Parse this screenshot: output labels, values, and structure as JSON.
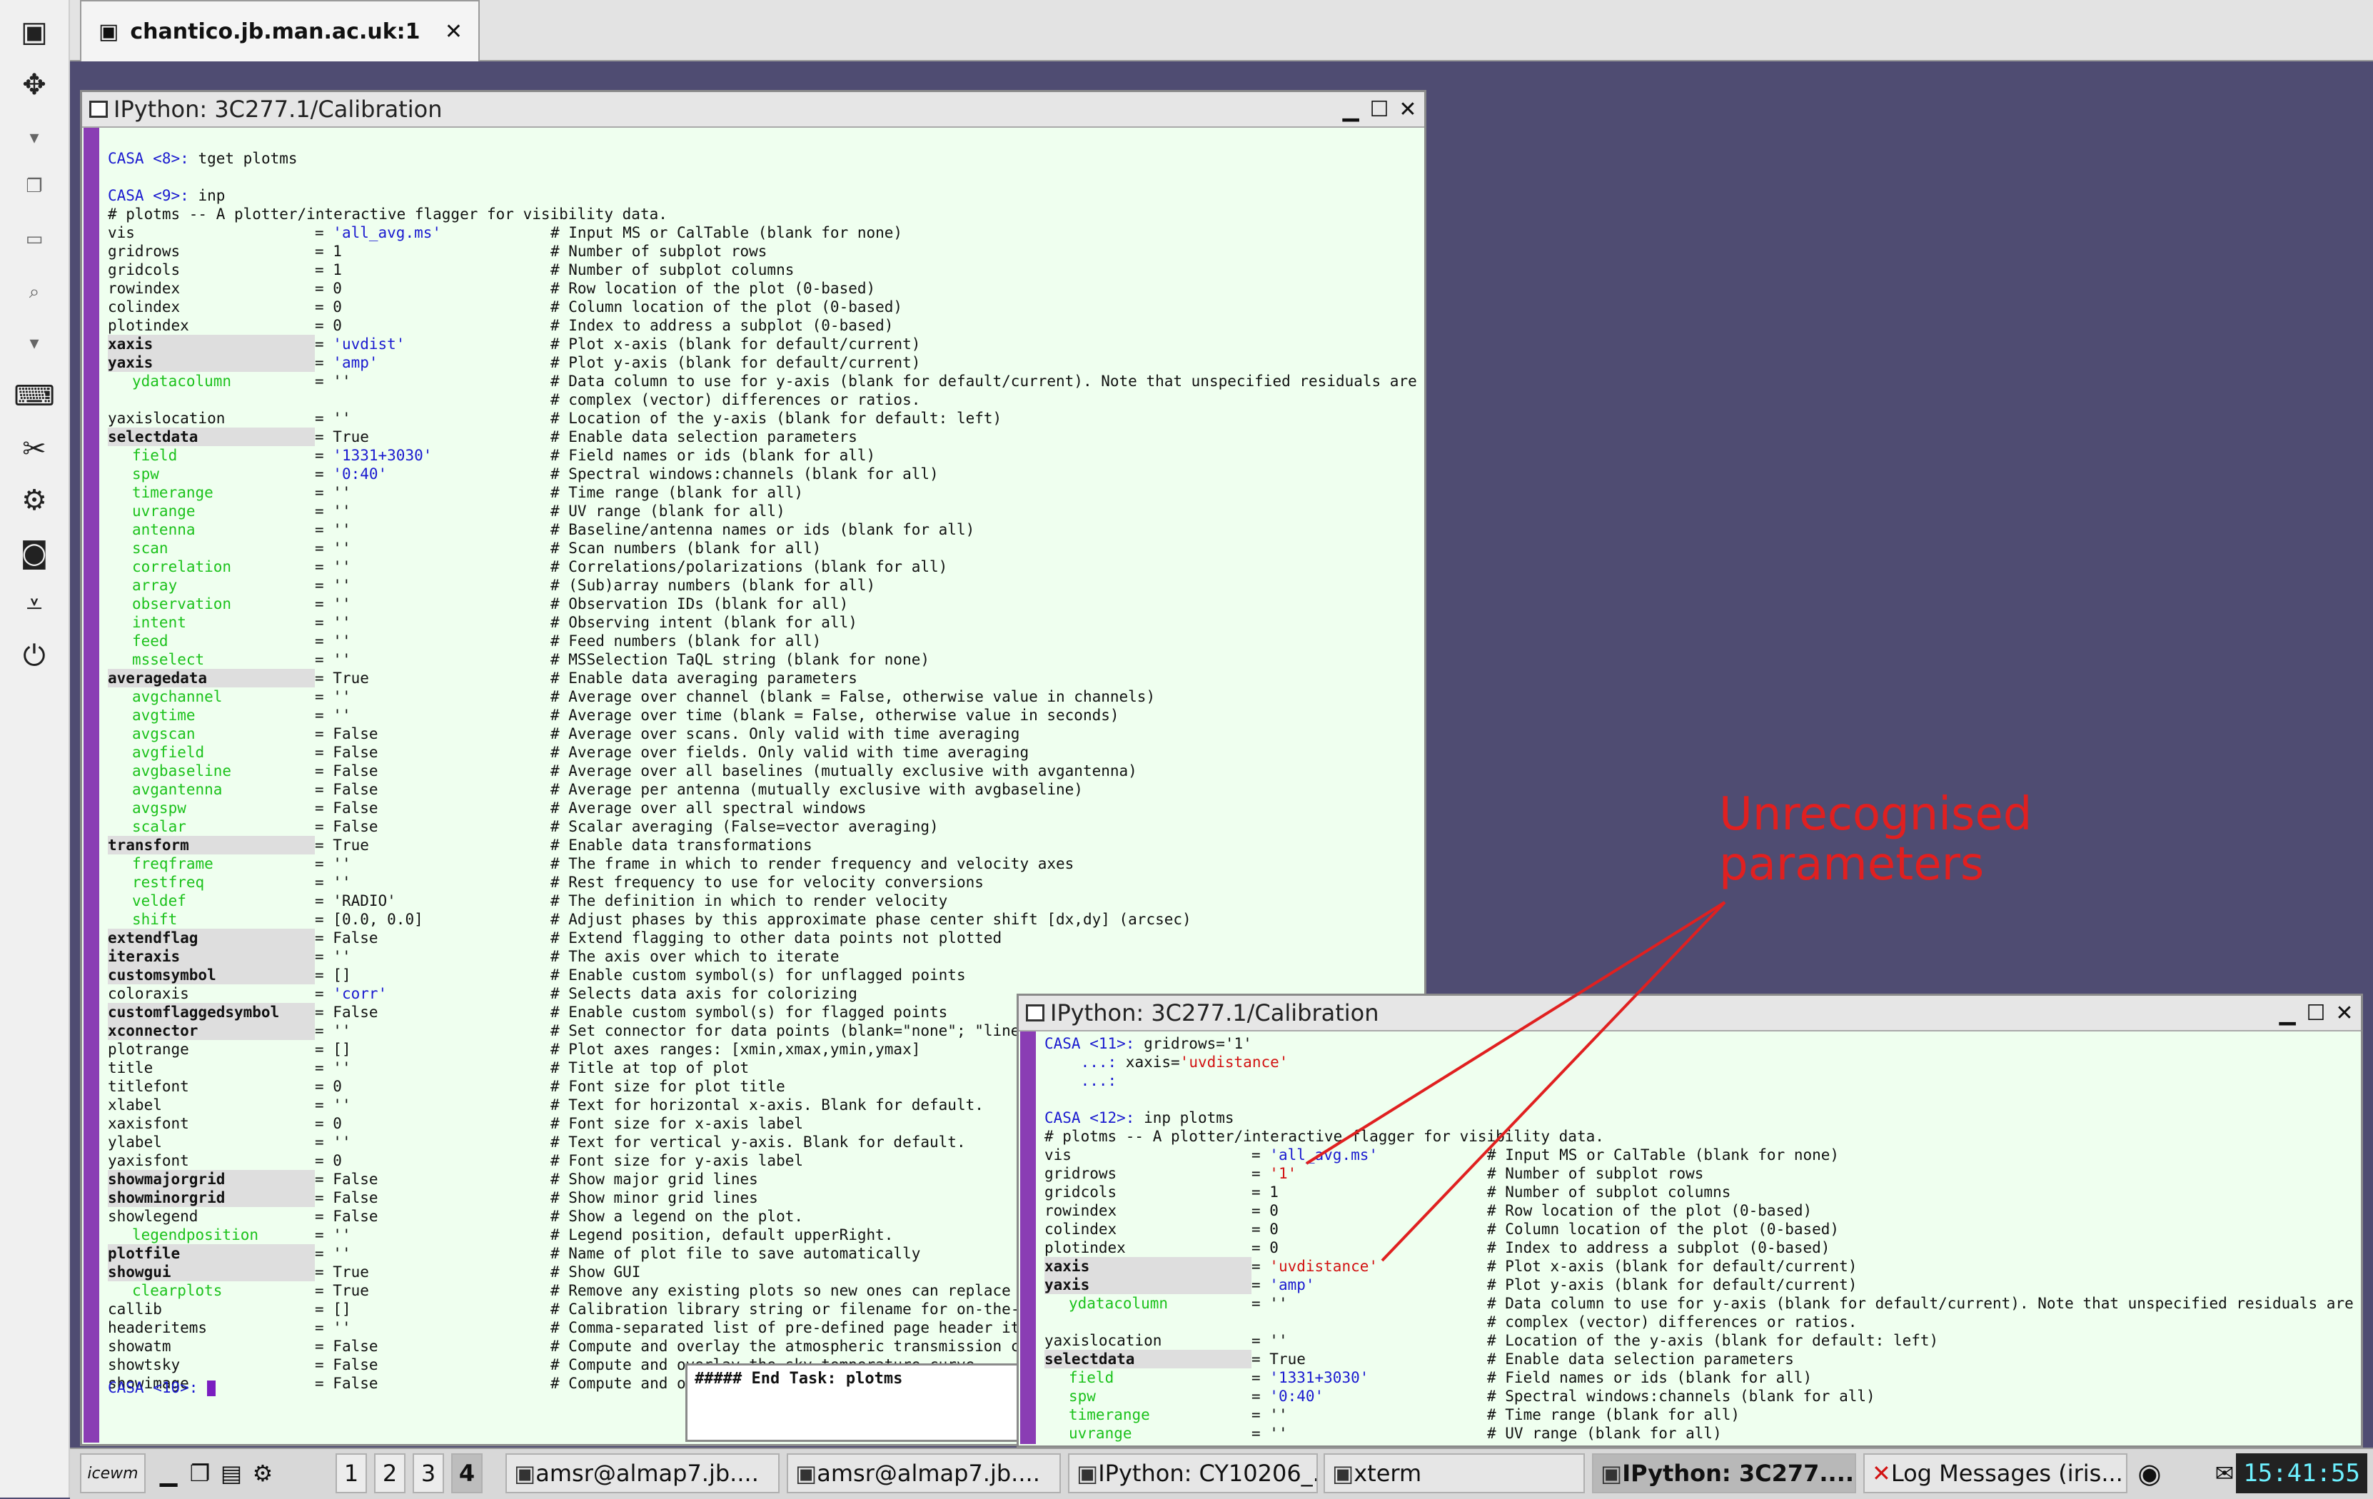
{
  "vnc_tab": {
    "title": "chantico.jb.man.ac.uk:1"
  },
  "window_main": {
    "title": "IPython: 3C277.1/Calibration",
    "prompt_tget_label": "CASA <8>:",
    "prompt_tget_cmd": " tget plotms",
    "prompt_inp_label": "CASA <9>:",
    "prompt_inp_cmd": " inp",
    "header": "# plotms -- A plotter/interactive flagger for visibility data.",
    "params": [
      {
        "name": "vis",
        "style": "plain",
        "value": "'all_avg.ms'",
        "vclass": "blue",
        "comment": "# Input MS or CalTable (blank for none)"
      },
      {
        "name": "gridrows",
        "style": "plain",
        "value": "1",
        "vclass": "",
        "comment": "# Number of subplot rows"
      },
      {
        "name": "gridcols",
        "style": "plain",
        "value": "1",
        "vclass": "",
        "comment": "# Number of subplot columns"
      },
      {
        "name": "rowindex",
        "style": "plain",
        "value": "0",
        "vclass": "",
        "comment": "# Row location of the plot (0-based)"
      },
      {
        "name": "colindex",
        "style": "plain",
        "value": "0",
        "vclass": "",
        "comment": "# Column location of the plot (0-based)"
      },
      {
        "name": "plotindex",
        "style": "plain",
        "value": "0",
        "vclass": "",
        "comment": "# Index to address a subplot (0-based)"
      },
      {
        "name": "xaxis",
        "style": "hi",
        "value": "'uvdist'",
        "vclass": "blue",
        "comment": "# Plot x-axis (blank for default/current)"
      },
      {
        "name": "yaxis",
        "style": "hi",
        "value": "'amp'",
        "vclass": "blue",
        "comment": "# Plot y-axis (blank for default/current)"
      },
      {
        "name": "ydatacolumn",
        "style": "sub",
        "value": "''",
        "vclass": "",
        "comment": "# Data column to use for y-axis (blank for default/current). Note that unspecified residuals are"
      },
      {
        "name": "",
        "style": "plain",
        "value": "",
        "vclass": "",
        "comment": "# complex (vector) differences or ratios."
      },
      {
        "name": "yaxislocation",
        "style": "plain",
        "value": "''",
        "vclass": "",
        "comment": "# Location of the y-axis (blank for default: left)"
      },
      {
        "name": "selectdata",
        "style": "hi",
        "value": "True",
        "vclass": "",
        "comment": "# Enable data selection parameters"
      },
      {
        "name": "field",
        "style": "sub",
        "value": "'1331+3030'",
        "vclass": "blue",
        "comment": "# Field names or ids (blank for all)"
      },
      {
        "name": "spw",
        "style": "sub",
        "value": "'0:40'",
        "vclass": "blue",
        "comment": "# Spectral windows:channels (blank for all)"
      },
      {
        "name": "timerange",
        "style": "sub",
        "value": "''",
        "vclass": "",
        "comment": "# Time range (blank for all)"
      },
      {
        "name": "uvrange",
        "style": "sub",
        "value": "''",
        "vclass": "",
        "comment": "# UV range (blank for all)"
      },
      {
        "name": "antenna",
        "style": "sub",
        "value": "''",
        "vclass": "",
        "comment": "# Baseline/antenna names or ids (blank for all)"
      },
      {
        "name": "scan",
        "style": "sub",
        "value": "''",
        "vclass": "",
        "comment": "# Scan numbers (blank for all)"
      },
      {
        "name": "correlation",
        "style": "sub",
        "value": "''",
        "vclass": "",
        "comment": "# Correlations/polarizations (blank for all)"
      },
      {
        "name": "array",
        "style": "sub",
        "value": "''",
        "vclass": "",
        "comment": "# (Sub)array numbers (blank for all)"
      },
      {
        "name": "observation",
        "style": "sub",
        "value": "''",
        "vclass": "",
        "comment": "# Observation IDs (blank for all)"
      },
      {
        "name": "intent",
        "style": "sub",
        "value": "''",
        "vclass": "",
        "comment": "# Observing intent (blank for all)"
      },
      {
        "name": "feed",
        "style": "sub",
        "value": "''",
        "vclass": "",
        "comment": "# Feed numbers (blank for all)"
      },
      {
        "name": "msselect",
        "style": "sub",
        "value": "''",
        "vclass": "",
        "comment": "# MSSelection TaQL string (blank for none)"
      },
      {
        "name": "averagedata",
        "style": "hi",
        "value": "True",
        "vclass": "",
        "comment": "# Enable data averaging parameters"
      },
      {
        "name": "avgchannel",
        "style": "sub",
        "value": "''",
        "vclass": "",
        "comment": "# Average over channel (blank = False, otherwise value in channels)"
      },
      {
        "name": "avgtime",
        "style": "sub",
        "value": "''",
        "vclass": "",
        "comment": "# Average over time (blank = False, otherwise value in seconds)"
      },
      {
        "name": "avgscan",
        "style": "sub",
        "value": "False",
        "vclass": "",
        "comment": "# Average over scans. Only valid with time averaging"
      },
      {
        "name": "avgfield",
        "style": "sub",
        "value": "False",
        "vclass": "",
        "comment": "# Average over fields. Only valid with time averaging"
      },
      {
        "name": "avgbaseline",
        "style": "sub",
        "value": "False",
        "vclass": "",
        "comment": "# Average over all baselines (mutually exclusive with avgantenna)"
      },
      {
        "name": "avgantenna",
        "style": "sub",
        "value": "False",
        "vclass": "",
        "comment": "# Average per antenna (mutually exclusive with avgbaseline)"
      },
      {
        "name": "avgspw",
        "style": "sub",
        "value": "False",
        "vclass": "",
        "comment": "# Average over all spectral windows"
      },
      {
        "name": "scalar",
        "style": "sub",
        "value": "False",
        "vclass": "",
        "comment": "# Scalar averaging (False=vector averaging)"
      },
      {
        "name": "transform",
        "style": "hi",
        "value": "True",
        "vclass": "",
        "comment": "# Enable data transformations"
      },
      {
        "name": "freqframe",
        "style": "sub",
        "value": "''",
        "vclass": "",
        "comment": "# The frame in which to render frequency and velocity axes"
      },
      {
        "name": "restfreq",
        "style": "sub",
        "value": "''",
        "vclass": "",
        "comment": "# Rest frequency to use for velocity conversions"
      },
      {
        "name": "veldef",
        "style": "sub",
        "value": "'RADIO'",
        "vclass": "",
        "comment": "# The definition in which to render velocity"
      },
      {
        "name": "shift",
        "style": "sub",
        "value": "[0.0, 0.0]",
        "vclass": "",
        "comment": "# Adjust phases by this approximate phase center shift [dx,dy] (arcsec)"
      },
      {
        "name": "extendflag",
        "style": "hi",
        "value": "False",
        "vclass": "",
        "comment": "# Extend flagging to other data points not plotted"
      },
      {
        "name": "iteraxis",
        "style": "hi",
        "value": "''",
        "vclass": "",
        "comment": "# The axis over which to iterate"
      },
      {
        "name": "customsymbol",
        "style": "hi",
        "value": "[]",
        "vclass": "",
        "comment": "# Enable custom symbol(s) for unflagged points"
      },
      {
        "name": "coloraxis",
        "style": "plain",
        "value": "'corr'",
        "vclass": "blue",
        "comment": "# Selects data axis for colorizing"
      },
      {
        "name": "customflaggedsymbol",
        "style": "hi",
        "value": "False",
        "vclass": "",
        "comment": "# Enable custom symbol(s) for flagged points"
      },
      {
        "name": "xconnector",
        "style": "hi",
        "value": "''",
        "vclass": "",
        "comment": "# Set connector for data points (blank=\"none\"; \"line\",\"s"
      },
      {
        "name": "plotrange",
        "style": "plain",
        "value": "[]",
        "vclass": "",
        "comment": "# Plot axes ranges: [xmin,xmax,ymin,ymax]"
      },
      {
        "name": "title",
        "style": "plain",
        "value": "''",
        "vclass": "",
        "comment": "# Title at top of plot"
      },
      {
        "name": "titlefont",
        "style": "plain",
        "value": "0",
        "vclass": "",
        "comment": "# Font size for plot title"
      },
      {
        "name": "xlabel",
        "style": "plain",
        "value": "''",
        "vclass": "",
        "comment": "# Text for horizontal x-axis. Blank for default."
      },
      {
        "name": "xaxisfont",
        "style": "plain",
        "value": "0",
        "vclass": "",
        "comment": "# Font size for x-axis label"
      },
      {
        "name": "ylabel",
        "style": "plain",
        "value": "''",
        "vclass": "",
        "comment": "# Text for vertical y-axis. Blank for default."
      },
      {
        "name": "yaxisfont",
        "style": "plain",
        "value": "0",
        "vclass": "",
        "comment": "# Font size for y-axis label"
      },
      {
        "name": "showmajorgrid",
        "style": "hi",
        "value": "False",
        "vclass": "",
        "comment": "# Show major grid lines"
      },
      {
        "name": "showminorgrid",
        "style": "hi",
        "value": "False",
        "vclass": "",
        "comment": "# Show minor grid lines"
      },
      {
        "name": "showlegend",
        "style": "plain",
        "value": "False",
        "vclass": "",
        "comment": "# Show a legend on the plot."
      },
      {
        "name": "legendposition",
        "style": "sub",
        "value": "''",
        "vclass": "",
        "comment": "# Legend position, default upperRight."
      },
      {
        "name": "plotfile",
        "style": "hi",
        "value": "''",
        "vclass": "",
        "comment": "# Name of plot file to save automatically"
      },
      {
        "name": "showgui",
        "style": "hi",
        "value": "True",
        "vclass": "",
        "comment": "# Show GUI"
      },
      {
        "name": "clearplots",
        "style": "sub",
        "value": "True",
        "vclass": "",
        "comment": "# Remove any existing plots so new ones can replace them"
      },
      {
        "name": "callib",
        "style": "plain",
        "value": "[]",
        "vclass": "",
        "comment": "# Calibration library string or filename for on-the-fly"
      },
      {
        "name": "headeritems",
        "style": "plain",
        "value": "''",
        "vclass": "",
        "comment": "# Comma-separated list of pre-defined page header items."
      },
      {
        "name": "showatm",
        "style": "plain",
        "value": "False",
        "vclass": "",
        "comment": "# Compute and overlay the atmospheric transmission curve"
      },
      {
        "name": "showtsky",
        "style": "plain",
        "value": "False",
        "vclass": "",
        "comment": "# Compute and overlay the sky temperature curve"
      },
      {
        "name": "showimage",
        "style": "plain",
        "value": "False",
        "vclass": "",
        "comment": "# Compute and overlay the image sideband curve"
      }
    ],
    "final_prompt": "CASA <10>:"
  },
  "window_second": {
    "title": "IPython: 3C277.1/Calibration",
    "prompt11_label": "CASA <11>:",
    "prompt11_cmd": " gridrows='1'",
    "cont1_label": "    ...:",
    "cont1_cmd_a": " xaxis=",
    "cont1_cmd_b": "'uvdistance'",
    "cont2_label": "    ...:",
    "prompt12_label": "CASA <12>:",
    "prompt12_cmd": " inp plotms",
    "header": "# plotms -- A plotter/interactive flagger for visibility data.",
    "params": [
      {
        "name": "vis",
        "style": "plain",
        "value": "'all_avg.ms'",
        "vclass": "blue",
        "comment": "# Input MS or CalTable (blank for none)"
      },
      {
        "name": "gridrows",
        "style": "plain",
        "value": "'1'",
        "vclass": "red",
        "comment": "# Number of subplot rows"
      },
      {
        "name": "gridcols",
        "style": "plain",
        "value": "1",
        "vclass": "",
        "comment": "# Number of subplot columns"
      },
      {
        "name": "rowindex",
        "style": "plain",
        "value": "0",
        "vclass": "",
        "comment": "# Row location of the plot (0-based)"
      },
      {
        "name": "colindex",
        "style": "plain",
        "value": "0",
        "vclass": "",
        "comment": "# Column location of the plot (0-based)"
      },
      {
        "name": "plotindex",
        "style": "plain",
        "value": "0",
        "vclass": "",
        "comment": "# Index to address a subplot (0-based)"
      },
      {
        "name": "xaxis",
        "style": "hi",
        "value": "'uvdistance'",
        "vclass": "red",
        "comment": "# Plot x-axis (blank for default/current)"
      },
      {
        "name": "yaxis",
        "style": "hi",
        "value": "'amp'",
        "vclass": "blue",
        "comment": "# Plot y-axis (blank for default/current)"
      },
      {
        "name": "ydatacolumn",
        "style": "sub",
        "value": "''",
        "vclass": "",
        "comment": "# Data column to use for y-axis (blank for default/current). Note that unspecified residuals are"
      },
      {
        "name": "",
        "style": "plain",
        "value": "",
        "vclass": "",
        "comment": "# complex (vector) differences or ratios."
      },
      {
        "name": "yaxislocation",
        "style": "plain",
        "value": "''",
        "vclass": "",
        "comment": "# Location of the y-axis (blank for default: left)"
      },
      {
        "name": "selectdata",
        "style": "hi",
        "value": "True",
        "vclass": "",
        "comment": "# Enable data selection parameters"
      },
      {
        "name": "field",
        "style": "sub",
        "value": "'1331+3030'",
        "vclass": "blue",
        "comment": "# Field names or ids (blank for all)"
      },
      {
        "name": "spw",
        "style": "sub",
        "value": "'0:40'",
        "vclass": "blue",
        "comment": "# Spectral windows:channels (blank for all)"
      },
      {
        "name": "timerange",
        "style": "sub",
        "value": "''",
        "vclass": "",
        "comment": "# Time range (blank for all)"
      },
      {
        "name": "uvrange",
        "style": "sub",
        "value": "''",
        "vclass": "",
        "comment": "# UV range (blank for all)"
      }
    ]
  },
  "xterm_back": {
    "text": "##### End Task: plotms"
  },
  "annotation": {
    "line1": "Unrecognised",
    "line2": "parameters",
    "color": "#e02020"
  },
  "taskbar": {
    "start_label": "icewm",
    "desktops": [
      "1",
      "2",
      "3",
      "4"
    ],
    "active_desktop": "4",
    "tasks": [
      "amsr@almap7.jb....",
      "amsr@almap7.jb....",
      "IPython: CY10206_...",
      "xterm",
      "IPython: 3C277....",
      "Log Messages (iris..."
    ],
    "clock": "15:41:55"
  }
}
